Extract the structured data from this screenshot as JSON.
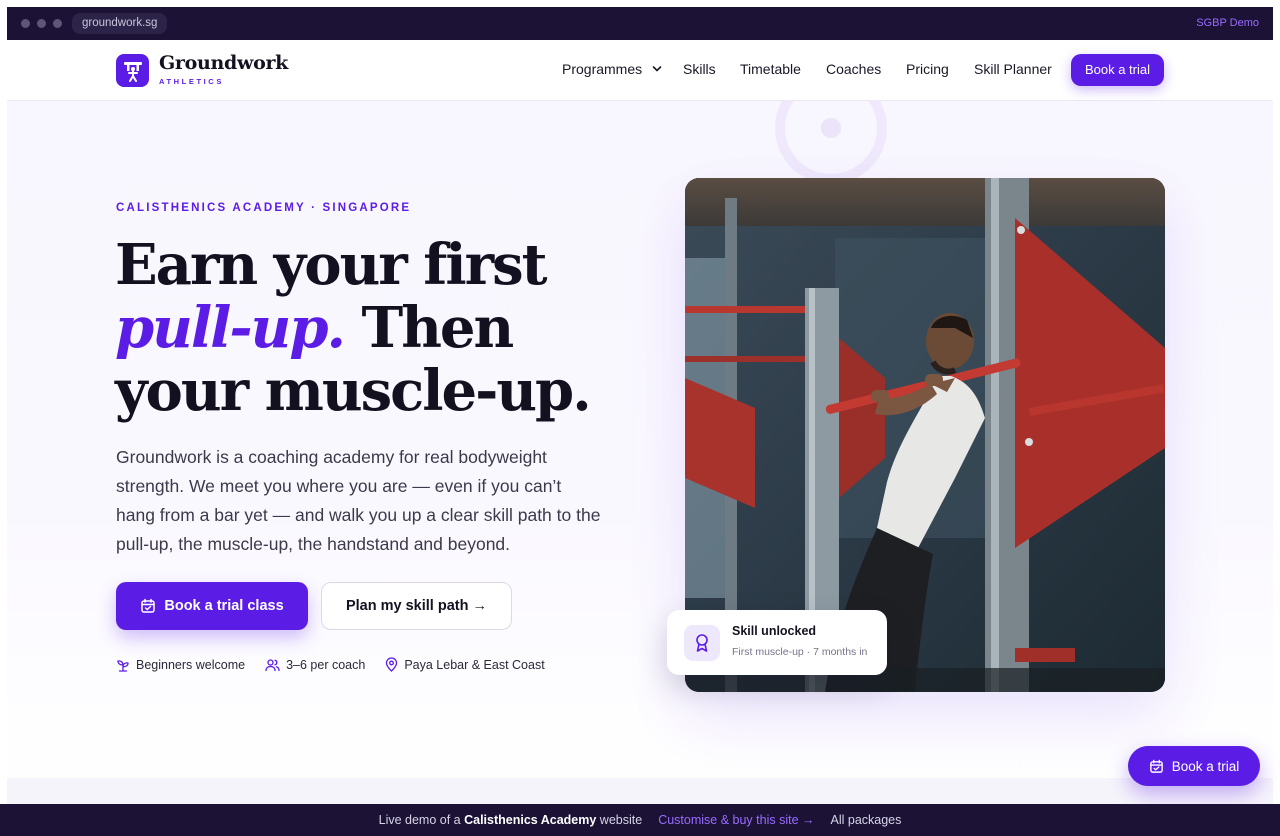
{
  "browser": {
    "url": "groundwork.sg",
    "demo_tag": "SGBP Demo"
  },
  "brand": {
    "name": "Groundwork",
    "tagline": "ATHLETICS",
    "accent_color": "#5b1de6"
  },
  "nav": {
    "items": [
      {
        "label": "Programmes",
        "dropdown": true
      },
      {
        "label": "Skills"
      },
      {
        "label": "Timetable"
      },
      {
        "label": "Coaches"
      },
      {
        "label": "Pricing"
      },
      {
        "label": "Skill Planner"
      }
    ],
    "cta_label": "Book a trial"
  },
  "hero": {
    "eyebrow": "CALISTHENICS ACADEMY · SINGAPORE",
    "headline_part1": "Earn your first",
    "headline_accent": "pull-up.",
    "headline_part2": " Then your muscle-up.",
    "lead": "Groundwork is a coaching academy for real bodyweight strength. We meet you where you are — even if you can’t hang from a bar yet — and walk you up a clear skill path to the pull-up, the muscle-up, the handstand and beyond.",
    "primary_cta": "Book a trial class",
    "secondary_cta": "Plan my skill path →",
    "chips": [
      {
        "icon": "sprout-icon",
        "label": "Beginners welcome"
      },
      {
        "icon": "users-icon",
        "label": "3–6 per coach"
      },
      {
        "icon": "location-pin-icon",
        "label": "Paya Lebar & East Coast"
      }
    ]
  },
  "toast": {
    "icon": "medal-icon",
    "title": "Skill unlocked",
    "subtitle": "First muscle-up · 7 months in"
  },
  "floating_cta": "Book a trial",
  "demo_bar": {
    "prefix": "Live demo of a ",
    "site_type": "Calisthenics Academy",
    "suffix": " website",
    "link": "Customise & buy this site →",
    "packages": "All packages"
  }
}
